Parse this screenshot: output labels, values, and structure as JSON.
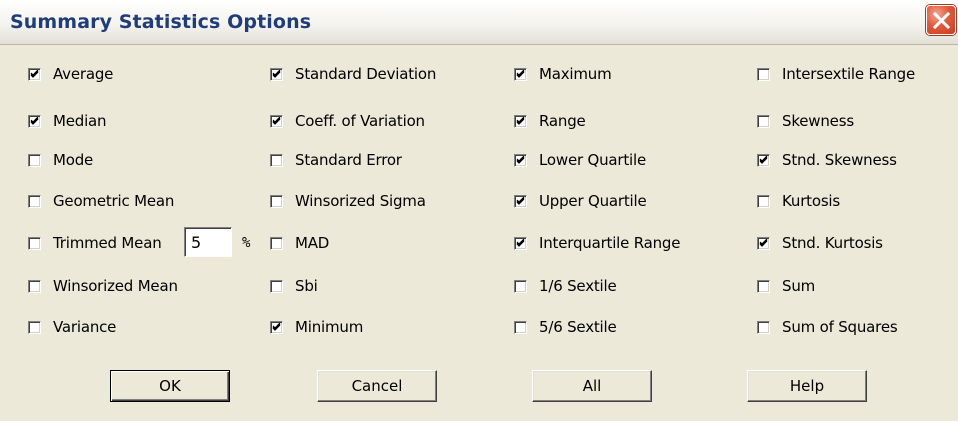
{
  "window": {
    "title": "Summary Statistics Options"
  },
  "options": [
    {
      "label": "Average",
      "checked": true
    },
    {
      "label": "Median",
      "checked": true
    },
    {
      "label": "Mode",
      "checked": false
    },
    {
      "label": "Geometric Mean",
      "checked": false
    },
    {
      "label": "Trimmed Mean",
      "checked": false
    },
    {
      "label": "Winsorized Mean",
      "checked": false
    },
    {
      "label": "Variance",
      "checked": false
    },
    {
      "label": "Standard Deviation",
      "checked": true
    },
    {
      "label": "Coeff. of Variation",
      "checked": true
    },
    {
      "label": "Standard Error",
      "checked": false
    },
    {
      "label": "Winsorized Sigma",
      "checked": false
    },
    {
      "label": "MAD",
      "checked": false
    },
    {
      "label": "Sbi",
      "checked": false
    },
    {
      "label": "Minimum",
      "checked": true
    },
    {
      "label": "Maximum",
      "checked": true
    },
    {
      "label": "Range",
      "checked": true
    },
    {
      "label": "Lower Quartile",
      "checked": true
    },
    {
      "label": "Upper Quartile",
      "checked": true
    },
    {
      "label": "Interquartile Range",
      "checked": true
    },
    {
      "label": "1/6 Sextile",
      "checked": false
    },
    {
      "label": "5/6 Sextile",
      "checked": false
    },
    {
      "label": "Intersextile Range",
      "checked": false
    },
    {
      "label": "Skewness",
      "checked": false
    },
    {
      "label": "Stnd. Skewness",
      "checked": true
    },
    {
      "label": "Kurtosis",
      "checked": false
    },
    {
      "label": "Stnd. Kurtosis",
      "checked": true
    },
    {
      "label": "Sum",
      "checked": false
    },
    {
      "label": "Sum of Squares",
      "checked": false
    }
  ],
  "trimmed_mean": {
    "value": "5",
    "unit": "%"
  },
  "buttons": {
    "ok": "OK",
    "cancel": "Cancel",
    "all": "All",
    "help": "Help"
  }
}
